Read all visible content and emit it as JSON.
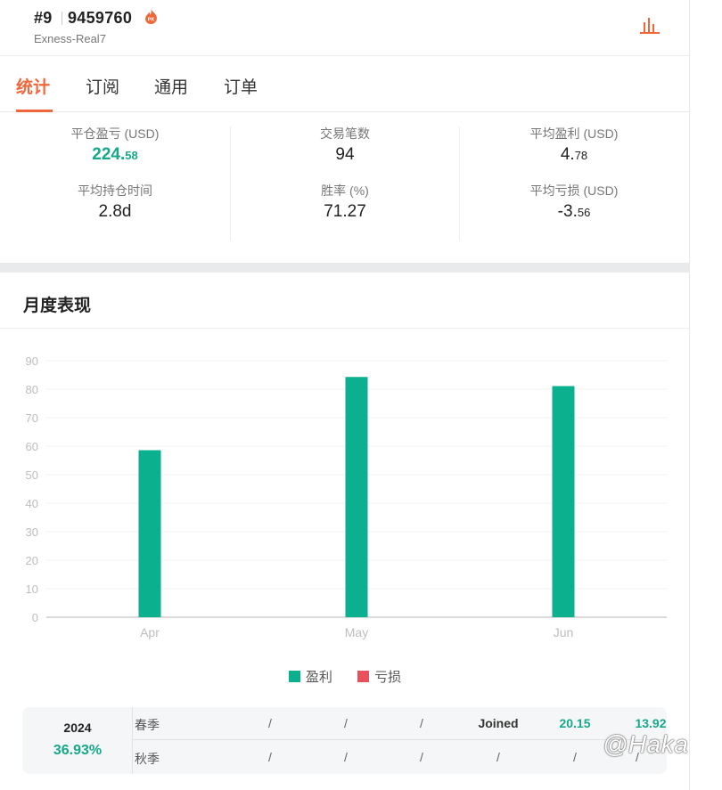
{
  "header": {
    "rank": "#9",
    "account_id": "9459760",
    "server": "Exness-Real7",
    "fire_icon": "fire-pk-icon",
    "chart_icon": "bar-chart-icon",
    "accent_color": "#f0673c"
  },
  "tabs": [
    {
      "label": "统计",
      "active": true
    },
    {
      "label": "订阅",
      "active": false
    },
    {
      "label": "通用",
      "active": false
    },
    {
      "label": "订单",
      "active": false
    }
  ],
  "stats": [
    {
      "label": "平仓盈亏 (USD)",
      "int": "224.",
      "dec": "58",
      "color": "green"
    },
    {
      "label": "交易笔数",
      "int": "94",
      "dec": ""
    },
    {
      "label": "平均盈利 (USD)",
      "int": "4.",
      "dec": "78"
    },
    {
      "label": "平均持仓时间",
      "int": "2.8d",
      "dec": ""
    },
    {
      "label": "胜率 (%)",
      "int": "71.27",
      "dec": ""
    },
    {
      "label": "平均亏损 (USD)",
      "int": "-3.",
      "dec": "56"
    }
  ],
  "monthly": {
    "title": "月度表现"
  },
  "chart_data": {
    "type": "bar",
    "categories": [
      "Apr",
      "May",
      "Jun"
    ],
    "series": [
      {
        "name": "盈利",
        "color": "#0bb08f",
        "values": [
          58.6,
          84.3,
          81.1
        ]
      },
      {
        "name": "亏损",
        "color": "#e8505b",
        "values": [
          0,
          0,
          0
        ]
      }
    ],
    "yticks": [
      "0",
      "10",
      "20",
      "30",
      "40",
      "50",
      "60",
      "70",
      "80",
      "90"
    ],
    "ylim": [
      0,
      90
    ],
    "grid": true,
    "legend": "bottom-center"
  },
  "legend": [
    {
      "label": "盈利",
      "color": "#0bb08f"
    },
    {
      "label": "亏损",
      "color": "#e8505b"
    }
  ],
  "year_table": {
    "year": "2024",
    "pct": "36.93%",
    "rows": [
      {
        "season": "春季",
        "cells": [
          "/",
          "/",
          "/",
          "Joined",
          "20.15",
          "13.92"
        ]
      },
      {
        "season": "秋季",
        "cells": [
          "/",
          "/",
          "/",
          "/",
          "/",
          "/"
        ]
      }
    ]
  },
  "watermark": "@Haka"
}
